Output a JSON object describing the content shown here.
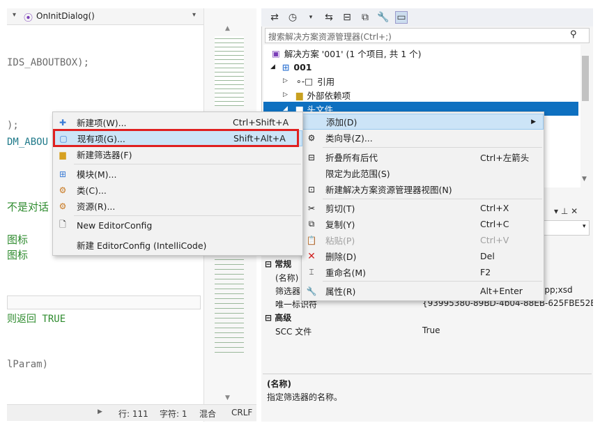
{
  "editor": {
    "nav_dropdown_left": "▾",
    "nav_dropdown_func": "OnInitDialog()",
    "code_lines": [
      "IDS_ABOUTBOX);",
      ");",
      "DM_ABOU",
      "不是对话",
      "图标",
      "图标",
      "则返回 TRUE",
      "lParam)"
    ],
    "split_icon": "÷"
  },
  "status": {
    "line": "行: 111",
    "char": "字符: 1",
    "mixed": "混合",
    "eol": "CRLF"
  },
  "explorer": {
    "search_placeholder": "搜索解决方案资源管理器(Ctrl+;)",
    "tree": [
      {
        "label": "解决方案 '001' (1 个项目, 共 1 个)"
      },
      {
        "label": "001"
      },
      {
        "label": "引用"
      },
      {
        "label": "外部依赖项"
      },
      {
        "label": "头文件"
      }
    ]
  },
  "properties": {
    "section_general": "常规",
    "row_name_label": "(名称)",
    "row_filter_label": "筛选器",
    "row_filter_value": "ipp;xsd",
    "row_id_label": "唯一标识符",
    "row_id_value": "{93995380-89BD-4b04-88EB-625FBE52E",
    "section_advanced": "高级",
    "row_scc_label": "SCC 文件",
    "row_scc_value": "True",
    "desc_title": "(名称)",
    "desc_text": "指定筛选器的名称。"
  },
  "submenu": {
    "items": [
      {
        "label": "新建项(W)...",
        "shortcut": "Ctrl+Shift+A",
        "icon": "new-item-icon"
      },
      {
        "label": "现有项(G)...",
        "shortcut": "Shift+Alt+A",
        "icon": "existing-item-icon"
      },
      {
        "label": "新建筛选器(F)",
        "shortcut": "",
        "icon": "new-filter-icon"
      },
      {
        "label": "模块(M)...",
        "shortcut": "",
        "icon": "module-icon"
      },
      {
        "label": "类(C)...",
        "shortcut": "",
        "icon": "class-icon"
      },
      {
        "label": "资源(R)...",
        "shortcut": "",
        "icon": "resource-icon"
      },
      {
        "label": "New EditorConfig",
        "shortcut": "",
        "icon": "editorconfig-icon"
      },
      {
        "label": "新建 EditorConfig (IntelliCode)",
        "shortcut": "",
        "icon": ""
      }
    ]
  },
  "context_menu": {
    "items": [
      {
        "label": "添加(D)",
        "shortcut": ""
      },
      {
        "label": "类向导(Z)...",
        "shortcut": ""
      },
      {
        "label": "折叠所有后代",
        "shortcut": "Ctrl+左箭头"
      },
      {
        "label": "限定为此范围(S)",
        "shortcut": ""
      },
      {
        "label": "新建解决方案资源管理器视图(N)",
        "shortcut": ""
      },
      {
        "label": "剪切(T)",
        "shortcut": "Ctrl+X"
      },
      {
        "label": "复制(Y)",
        "shortcut": "Ctrl+C"
      },
      {
        "label": "粘贴(P)",
        "shortcut": "Ctrl+V"
      },
      {
        "label": "删除(D)",
        "shortcut": "Del"
      },
      {
        "label": "重命名(M)",
        "shortcut": "F2"
      },
      {
        "label": "属性(R)",
        "shortcut": "Alt+Enter"
      }
    ]
  },
  "colors": {
    "highlight": "#cce4f7",
    "selection": "#0e70c0",
    "callout": "#e02020"
  }
}
